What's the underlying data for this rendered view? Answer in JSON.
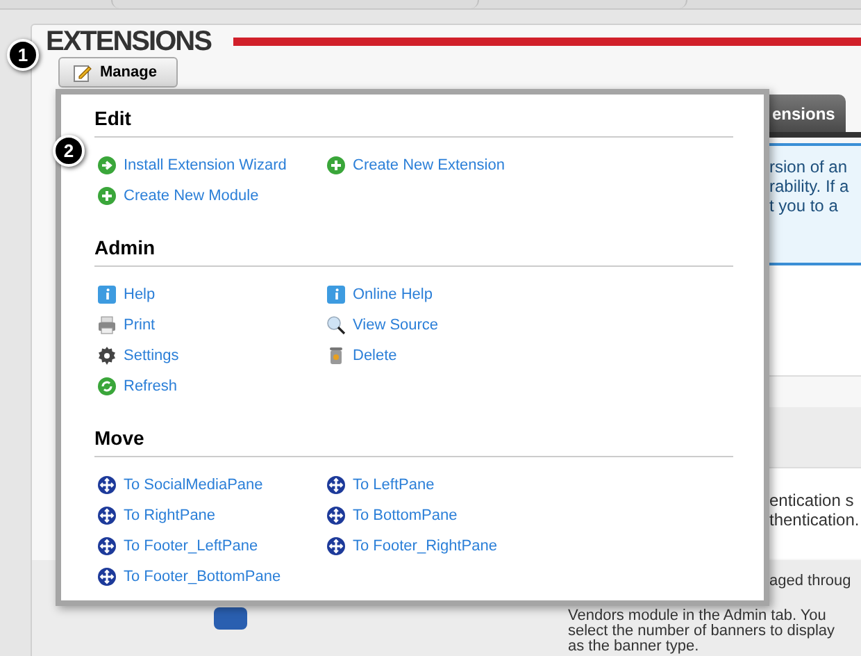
{
  "page": {
    "title": "EXTENSIONS"
  },
  "manage_button": {
    "label": "Manage"
  },
  "callouts": [
    "1",
    "2"
  ],
  "tab": {
    "label": "ensions"
  },
  "info_lines": [
    "rsion of an",
    "rability. If a",
    "t you to a"
  ],
  "row_lines": [
    "entication s",
    "thentication."
  ],
  "banner_lines": [
    "aged throug",
    "Vendors module in the Admin tab. You",
    "select the number of banners to display",
    "as the banner type."
  ],
  "menu": {
    "sections": [
      {
        "title": "Edit",
        "items": [
          {
            "label": "Install Extension Wizard",
            "kind": "wizard"
          },
          {
            "label": "Create New Extension",
            "kind": "add"
          },
          {
            "label": "Create New Module",
            "kind": "add"
          }
        ]
      },
      {
        "title": "Admin",
        "items": [
          {
            "label": "Help",
            "kind": "help"
          },
          {
            "label": "Online Help",
            "kind": "help"
          },
          {
            "label": "Print",
            "kind": "print"
          },
          {
            "label": "View Source",
            "kind": "view"
          },
          {
            "label": "Settings",
            "kind": "settings"
          },
          {
            "label": "Delete",
            "kind": "delete"
          },
          {
            "label": "Refresh",
            "kind": "refresh"
          }
        ]
      },
      {
        "title": "Move",
        "items": [
          {
            "label": "To SocialMediaPane",
            "kind": "move"
          },
          {
            "label": "To LeftPane",
            "kind": "move"
          },
          {
            "label": "To RightPane",
            "kind": "move"
          },
          {
            "label": "To BottomPane",
            "kind": "move"
          },
          {
            "label": "To Footer_LeftPane",
            "kind": "move"
          },
          {
            "label": "To Footer_RightPane",
            "kind": "move"
          },
          {
            "label": "To Footer_BottomPane",
            "kind": "move"
          }
        ]
      }
    ]
  }
}
